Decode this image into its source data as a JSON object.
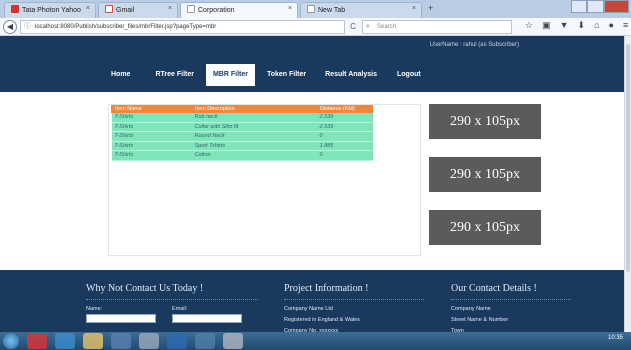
{
  "browser": {
    "tabs": [
      {
        "label": "Tata Photon Yahoo",
        "color": "#d6322b"
      },
      {
        "label": "Gmail",
        "color": "#e04a3c"
      },
      {
        "label": "Corporation",
        "color": "#ffffff"
      },
      {
        "label": "New Tab",
        "color": "#ffffff"
      }
    ],
    "url": "localhost:8080/Publish/subscriber_files/mbrFilter.jsp?pageType=mbr",
    "search_placeholder": "Search"
  },
  "header": {
    "user_line": "UserName : rahul (as Subscriber)",
    "menu": [
      "Home",
      "RTree Filter",
      "MBR Filter",
      "Token Filter",
      "Result Analysis",
      "Logout"
    ],
    "active_menu": "MBR Filter"
  },
  "table": {
    "columns": [
      "Item Name",
      "Item Description",
      "Distance (KM)"
    ],
    "rows": [
      [
        "T-Shirts",
        "Rob neck",
        "2.539"
      ],
      [
        "T-Shirts",
        "Collar with Slim fit",
        "2.539"
      ],
      [
        "T-Shirts",
        "Round Neck",
        "0"
      ],
      [
        "T-Shirts",
        "Sport Tshirts",
        "1.885"
      ],
      [
        "T-Shirts",
        "Cotton",
        "0"
      ]
    ]
  },
  "ads": [
    "290 x 105px",
    "290 x 105px",
    "290 x 105px"
  ],
  "footer": {
    "contact_title": "Why Not Contact Us Today !",
    "name_label": "Name:",
    "email_label": "Email:",
    "project_title": "Project Information !",
    "project_lines": [
      "Company Name Ltd",
      "Registered in England & Wales",
      "Company No. xxxxxxx"
    ],
    "details_title": "Our Contact Details !",
    "details_lines": [
      "Company Name",
      "Street Name & Number",
      "Town"
    ]
  },
  "taskbar": {
    "time": "10:35"
  }
}
